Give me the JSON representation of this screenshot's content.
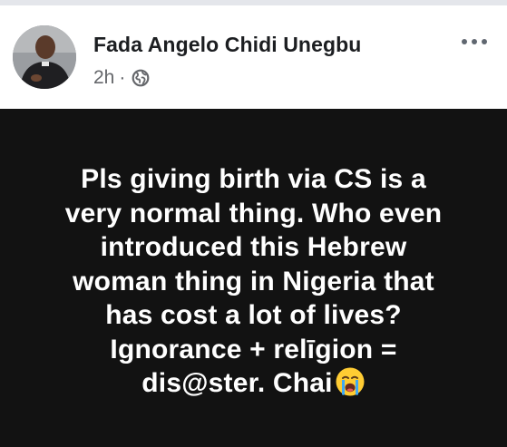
{
  "post": {
    "author_name": "Fada Angelo Chidi Unegbu",
    "timestamp": "2h",
    "separator": "·",
    "audience_icon": "globe-icon",
    "menu_icon": "more-options-icon",
    "status_lines": [
      "Pls giving birth via CS is a",
      "very normal thing. Who even",
      "introduced this Hebrew",
      "woman thing in Nigeria that",
      "has cost a lot of lives?",
      "Ignorance + relīgion =",
      "dis@ster. Chai"
    ],
    "status_emoji": "loudly-crying-face-icon",
    "card_background": "#121212",
    "text_color": "#ffffff"
  }
}
